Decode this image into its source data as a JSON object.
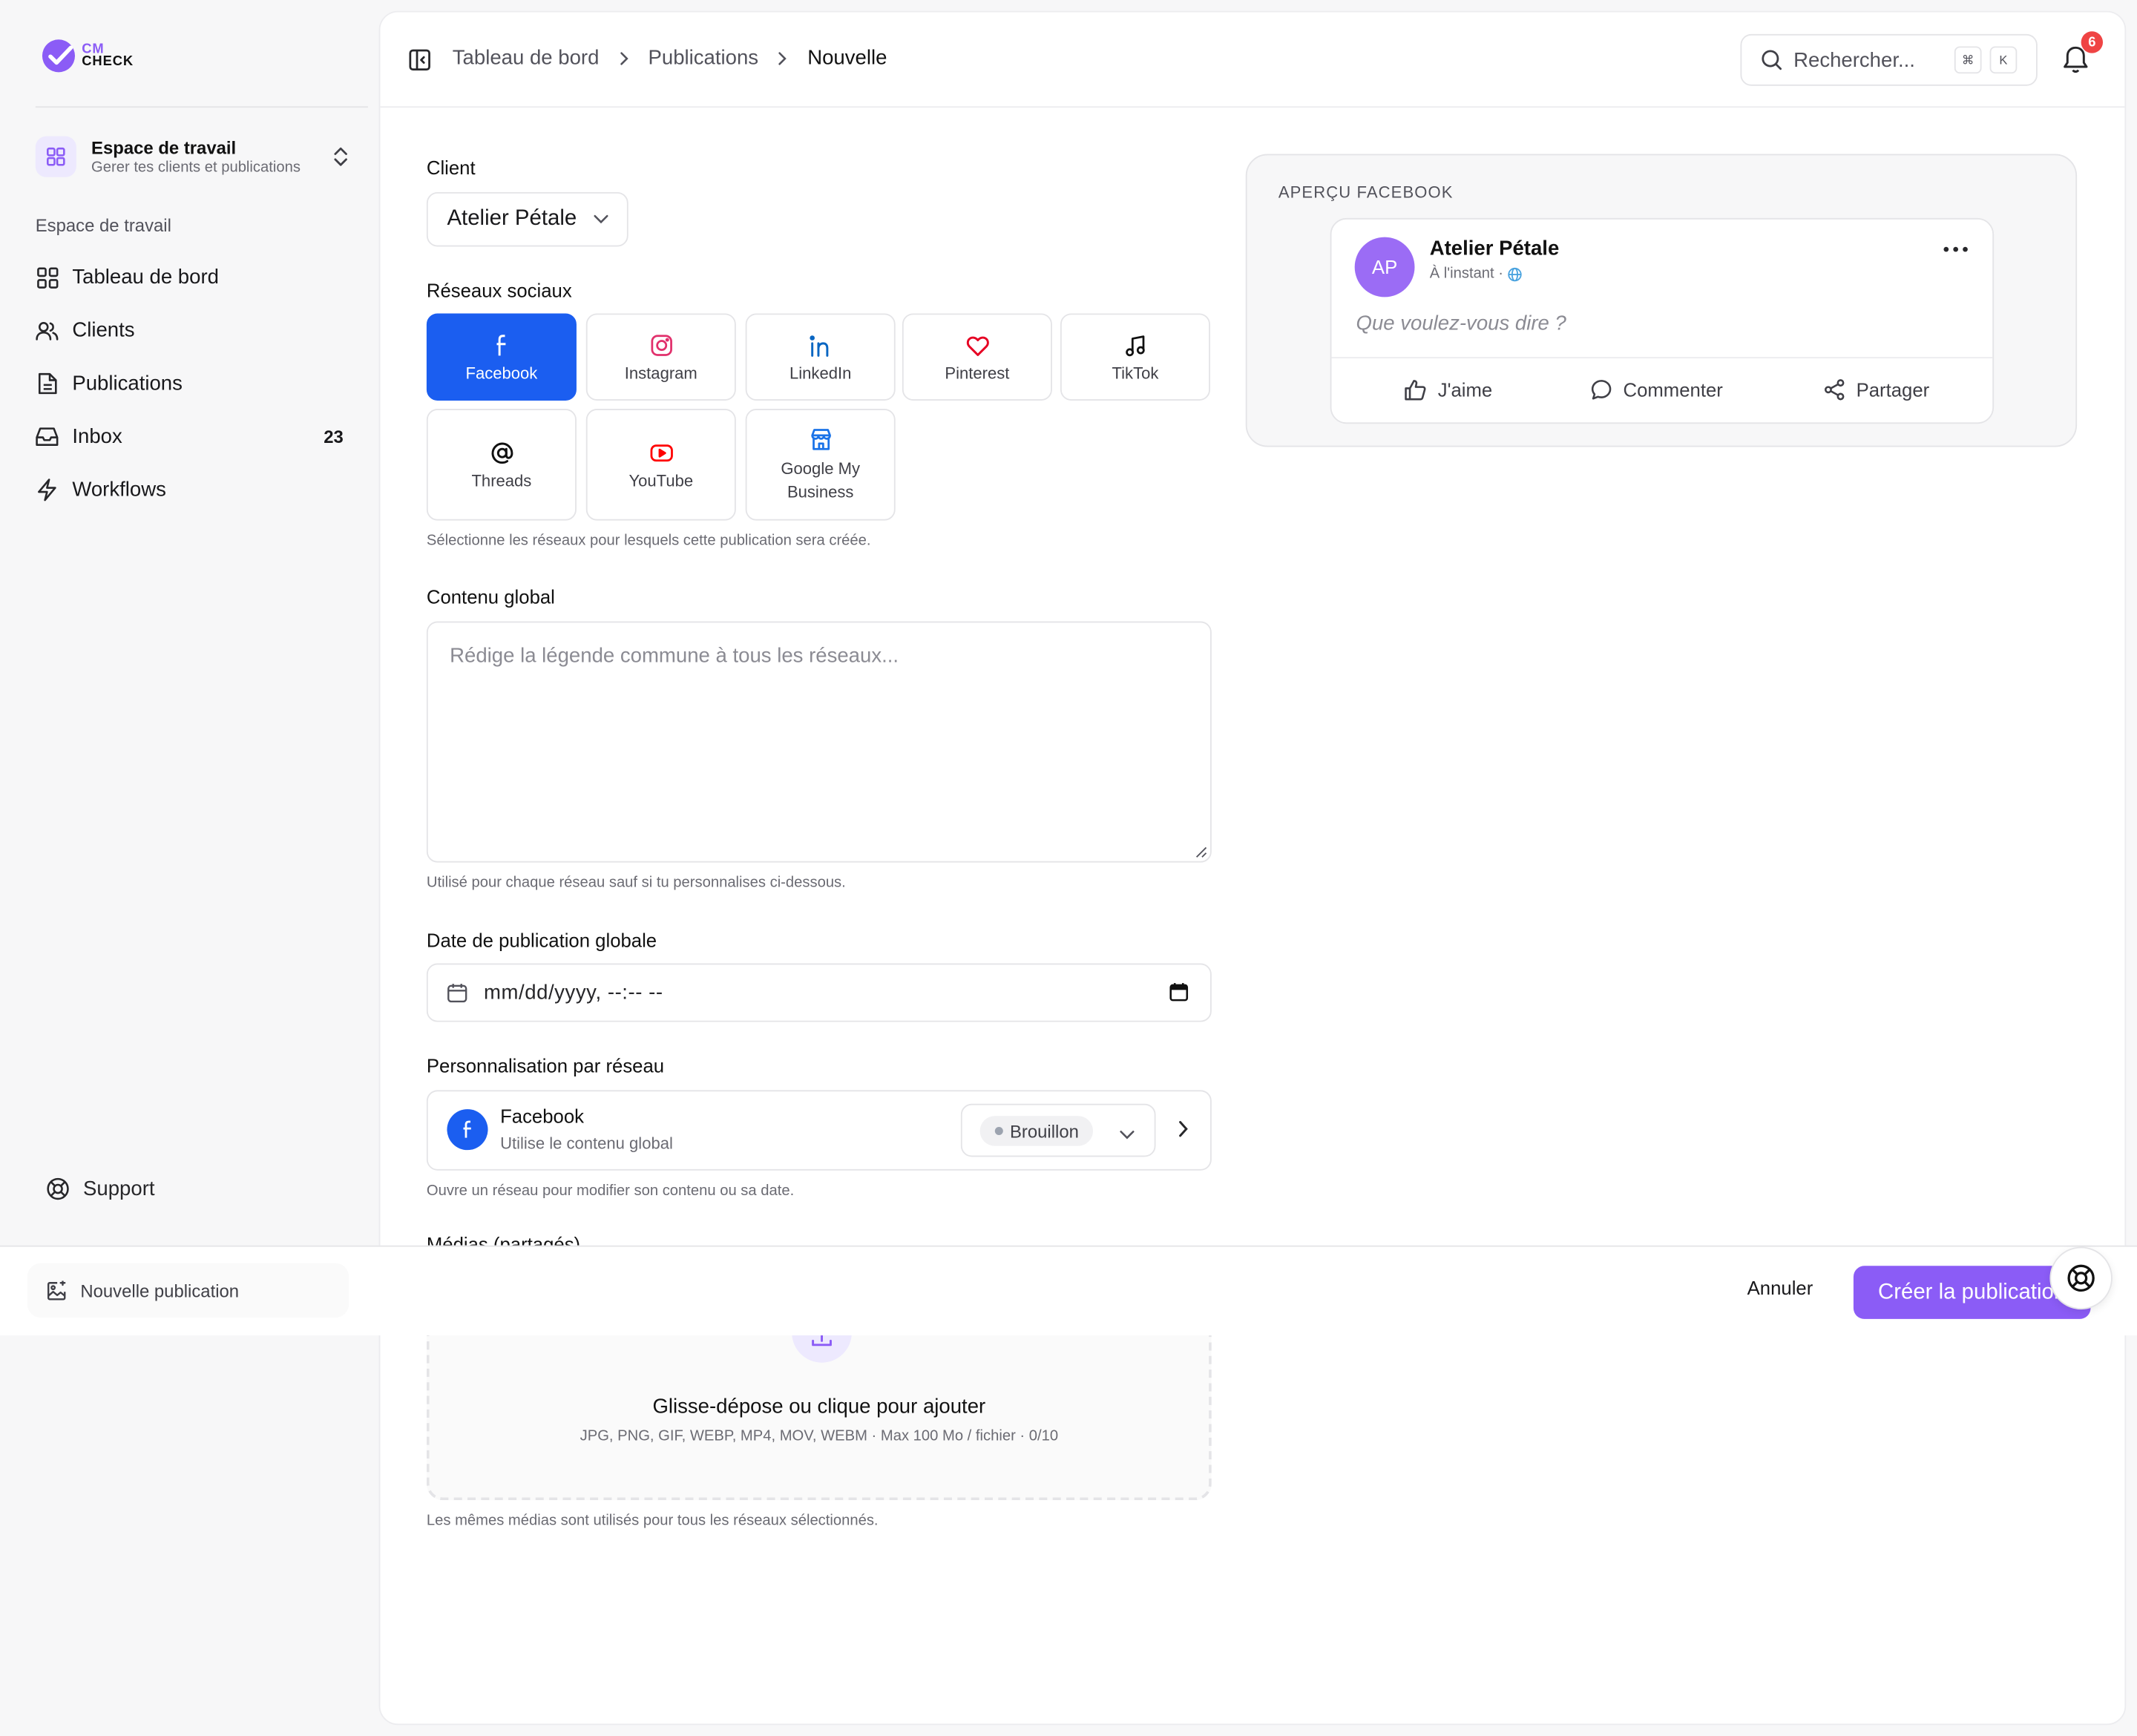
{
  "app": {
    "logo_top": "CM",
    "logo_bottom": "CHECK",
    "accent": "#8b5cf6",
    "facebook_blue": "#1b5ef0"
  },
  "sidebar": {
    "workspace": {
      "title": "Espace de travail",
      "subtitle": "Gerer tes clients et publications",
      "icon": "grid-icon"
    },
    "section_label": "Espace de travail",
    "items": [
      {
        "label": "Tableau de bord",
        "icon": "dashboard-icon"
      },
      {
        "label": "Clients",
        "icon": "users-icon"
      },
      {
        "label": "Publications",
        "icon": "document-icon"
      },
      {
        "label": "Inbox",
        "icon": "inbox-icon",
        "badge": "23"
      },
      {
        "label": "Workflows",
        "icon": "bolt-icon"
      }
    ],
    "support_label": "Support"
  },
  "header": {
    "breadcrumbs": [
      "Tableau de bord",
      "Publications",
      "Nouvelle"
    ],
    "search_placeholder": "Rechercher...",
    "kbd_mod": "⌘",
    "kbd_key": "K",
    "notification_count": "6"
  },
  "form": {
    "client_label": "Client",
    "client_value": "Atelier Pétale",
    "networks_label": "Réseaux sociaux",
    "networks": [
      {
        "label": "Facebook",
        "icon": "facebook-icon",
        "selected": true
      },
      {
        "label": "Instagram",
        "icon": "instagram-icon",
        "selected": false
      },
      {
        "label": "LinkedIn",
        "icon": "linkedin-icon",
        "selected": false
      },
      {
        "label": "Pinterest",
        "icon": "heart-icon",
        "selected": false
      },
      {
        "label": "TikTok",
        "icon": "music-note-icon",
        "selected": false
      },
      {
        "label": "Threads",
        "icon": "at-icon",
        "selected": false
      },
      {
        "label": "YouTube",
        "icon": "youtube-icon",
        "selected": false
      },
      {
        "label": "Google My Business",
        "icon": "store-icon",
        "selected": false
      }
    ],
    "networks_help": "Sélectionne les réseaux pour lesquels cette publication sera créée.",
    "content_label": "Contenu global",
    "content_placeholder": "Rédige la légende commune à tous les réseaux...",
    "content_help": "Utilisé pour chaque réseau sauf si tu personnalises ci-dessous.",
    "date_label": "Date de publication globale",
    "date_placeholder": "mm/dd/yyyy, --:-- --",
    "custom_label": "Personnalisation par réseau",
    "custom_row": {
      "name": "Facebook",
      "sub": "Utilise le contenu global",
      "status": "Brouillon"
    },
    "custom_help": "Ouvre un réseau pour modifier son contenu ou sa date.",
    "media_label": "Médias (partagés)",
    "dropzone_title": "Glisse-dépose ou clique pour ajouter",
    "dropzone_sub": "JPG, PNG, GIF, WEBP, MP4, MOV, WEBM · Max 100 Mo / fichier · 0/10",
    "media_help": "Les mêmes médias sont utilisés pour tous les réseaux sélectionnés."
  },
  "preview": {
    "label": "APERÇU FACEBOOK",
    "avatar": "AP",
    "name": "Atelier Pétale",
    "time": "À l'instant ·",
    "placeholder": "Que voulez-vous dire ?",
    "actions": [
      "J'aime",
      "Commenter",
      "Partager"
    ]
  },
  "bottom": {
    "tab_label": "Nouvelle publication",
    "cancel": "Annuler",
    "create": "Créer la publication"
  }
}
